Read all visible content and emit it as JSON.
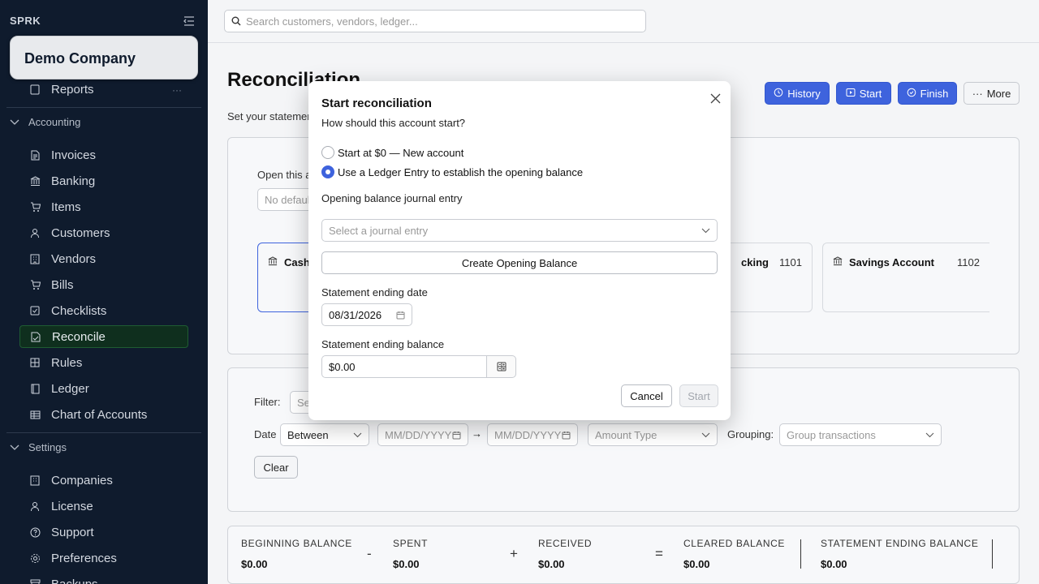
{
  "sidebar": {
    "brand": "SPRK",
    "company": "Demo Company",
    "reports": "Reports",
    "more_dots": "···",
    "accounting_group": "Accounting",
    "accounting_items": [
      {
        "label": "Invoices",
        "icon": "file-icon"
      },
      {
        "label": "Banking",
        "icon": "bank-icon"
      },
      {
        "label": "Items",
        "icon": "cart-icon"
      },
      {
        "label": "Customers",
        "icon": "user-icon"
      },
      {
        "label": "Vendors",
        "icon": "building-icon"
      },
      {
        "label": "Bills",
        "icon": "cart-icon"
      },
      {
        "label": "Checklists",
        "icon": "checkbox-icon"
      },
      {
        "label": "Reconcile",
        "icon": "reconcile-icon",
        "active": true
      },
      {
        "label": "Rules",
        "icon": "grid-icon"
      },
      {
        "label": "Ledger",
        "icon": "book-icon"
      },
      {
        "label": "Chart of Accounts",
        "icon": "table-icon"
      }
    ],
    "settings_group": "Settings",
    "settings_items": [
      {
        "label": "Companies",
        "icon": "building-icon"
      },
      {
        "label": "License",
        "icon": "user-icon"
      },
      {
        "label": "Support",
        "icon": "help-icon"
      },
      {
        "label": "Preferences",
        "icon": "gear-icon"
      },
      {
        "label": "Backups",
        "icon": "archive-icon"
      }
    ]
  },
  "topbar": {
    "search_placeholder": "Search customers, vendors, ledger..."
  },
  "header": {
    "title": "Reconciliation",
    "subtitle": "Set your statemen",
    "buttons": {
      "history": "History",
      "start": "Start",
      "finish": "Finish",
      "more": "More"
    }
  },
  "accounts_card": {
    "open_label": "Open this a",
    "default_placeholder": "No defaul",
    "accounts": [
      {
        "name": "Cash",
        "number": ""
      },
      {
        "name": "cking",
        "number": "1101"
      },
      {
        "name": "Savings Account",
        "number": "1102"
      }
    ]
  },
  "filters": {
    "filter_label": "Filter:",
    "filter_placeholder": "Se",
    "date_label": "Date",
    "date_mode": "Between",
    "date_from_placeholder": "MM/DD/YYYY",
    "date_to_placeholder": "MM/DD/YYYY",
    "arrow": "→",
    "amount_type_placeholder": "Amount Type",
    "grouping_label": "Grouping:",
    "grouping_placeholder": "Group transactions",
    "clear_label": "Clear"
  },
  "summary": {
    "beginning_label": "BEGINNING BALANCE",
    "beginning_value": "$0.00",
    "minus": "-",
    "spent_label": "SPENT",
    "spent_value": "$0.00",
    "plus": "+",
    "received_label": "RECEIVED",
    "received_value": "$0.00",
    "equals": "=",
    "cleared_label": "CLEARED BALANCE",
    "cleared_value": "$0.00",
    "statement_label": "STATEMENT ENDING BALANCE",
    "statement_value": "$0.00"
  },
  "modal": {
    "title": "Start reconciliation",
    "question": "How should this account start?",
    "option_zero": "Start at $0 — New account",
    "option_ledger": "Use a Ledger Entry to establish the opening balance",
    "selected_option": "ledger",
    "journal_label": "Opening balance journal entry",
    "journal_placeholder": "Select a journal entry",
    "create_button": "Create Opening Balance",
    "date_label": "Statement ending date",
    "date_value": "08/31/2026",
    "balance_label": "Statement ending balance",
    "balance_value": "$0.00",
    "cancel_button": "Cancel",
    "start_button": "Start"
  },
  "colors": {
    "sidebar_bg": "#0f1b2d",
    "primary": "#3e63dd",
    "active_nav_bg": "#0f2f1e"
  }
}
